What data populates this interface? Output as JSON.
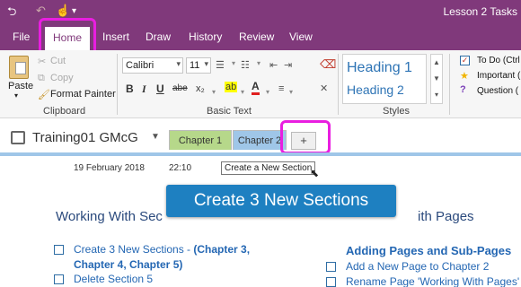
{
  "window": {
    "title": "Lesson 2 Tasks",
    "quick_access": {
      "back": "⮌",
      "undo": "↶",
      "touch": "☝",
      "more": "▾"
    }
  },
  "ribbon_tabs": [
    "File",
    "Home",
    "Insert",
    "Draw",
    "History",
    "Review",
    "View"
  ],
  "clipboard": {
    "label": "Clipboard",
    "paste": "Paste",
    "paste_dd": "▾",
    "cut": "Cut",
    "copy": "Copy",
    "format_painter": "Format Painter"
  },
  "basic_text": {
    "label": "Basic Text",
    "font": "Calibri",
    "size": "11",
    "bold": "B",
    "italic": "I",
    "underline": "U",
    "strike": "abe",
    "sub": "x₂",
    "highlight": "ab",
    "font_color": "A"
  },
  "styles": {
    "label": "Styles",
    "heading1": "Heading 1",
    "heading2": "Heading 2"
  },
  "tags": {
    "todo": "To Do (Ctrl",
    "important": "Important (",
    "question": "Question ("
  },
  "notebook": {
    "name": "Training01 GMcG",
    "sections": [
      "Chapter 1",
      "Chapter 2"
    ],
    "add_section": "+"
  },
  "page": {
    "date": "19 February 2018",
    "time": "22:10",
    "tooltip": "Create a New Section",
    "banner": "Create 3 New Sections",
    "left_heading": "Working With Sec",
    "right_heading": "ith Pages",
    "left_items": [
      {
        "line1": "Create 3 New Sections - ",
        "bold1": "(Chapter 3,",
        "line2": "Chapter 4, Chapter 5)"
      },
      {
        "line1": "Delete Section 5"
      }
    ],
    "right_subheading": "Adding Pages and Sub-Pages",
    "right_items": [
      "Add a New Page to Chapter 2",
      "Rename Page 'Working With Pages'"
    ]
  },
  "colors": {
    "onenote_purple": "#80397b",
    "highlight_pink": "#e91ee0",
    "banner_blue": "#1e80c1",
    "chapter1_green": "#b6d88a",
    "chapter2_blue": "#9fc6e8"
  }
}
